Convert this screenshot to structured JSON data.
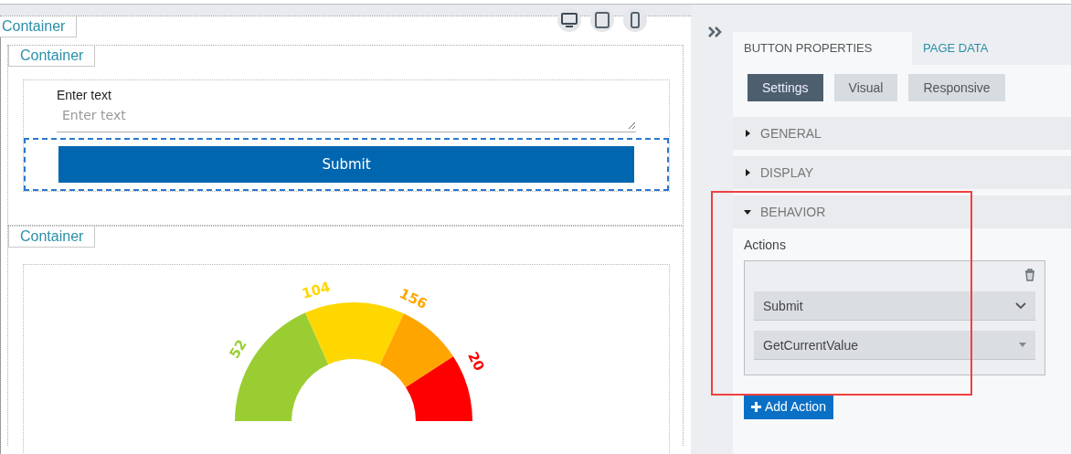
{
  "canvas": {
    "outer_container": {
      "label": "Container"
    },
    "form_container": {
      "label": "Container",
      "text_field": {
        "label": "Enter text",
        "placeholder": "Enter text"
      },
      "submit_button": {
        "label": "Submit",
        "selected": true
      }
    },
    "gauge_container": {
      "label": "Container",
      "segments": [
        {
          "label": "52",
          "color": "#9acd32"
        },
        {
          "label": "104",
          "color": "#ffd700"
        },
        {
          "label": "156",
          "color": "#ffa500"
        },
        {
          "label": "20",
          "color": "#ff0000"
        }
      ]
    }
  },
  "panel": {
    "tabs": [
      {
        "label": "BUTTON PROPERTIES",
        "selected": true
      },
      {
        "label": "PAGE DATA",
        "selected": false
      }
    ],
    "subtabs": [
      {
        "label": "Settings",
        "selected": true
      },
      {
        "label": "Visual",
        "selected": false
      },
      {
        "label": "Responsive",
        "selected": false
      }
    ],
    "sections": [
      {
        "label": "GENERAL",
        "expanded": false
      },
      {
        "label": "DISPLAY",
        "expanded": false
      },
      {
        "label": "BEHAVIOR",
        "expanded": true,
        "highlighted": true
      }
    ],
    "actions": {
      "label": "Actions",
      "dropdowns": [
        {
          "value": "Submit",
          "kind": "chevron"
        },
        {
          "value": "GetCurrentValue",
          "kind": "caret"
        }
      ]
    },
    "add_button": {
      "label": "Add Action"
    }
  }
}
